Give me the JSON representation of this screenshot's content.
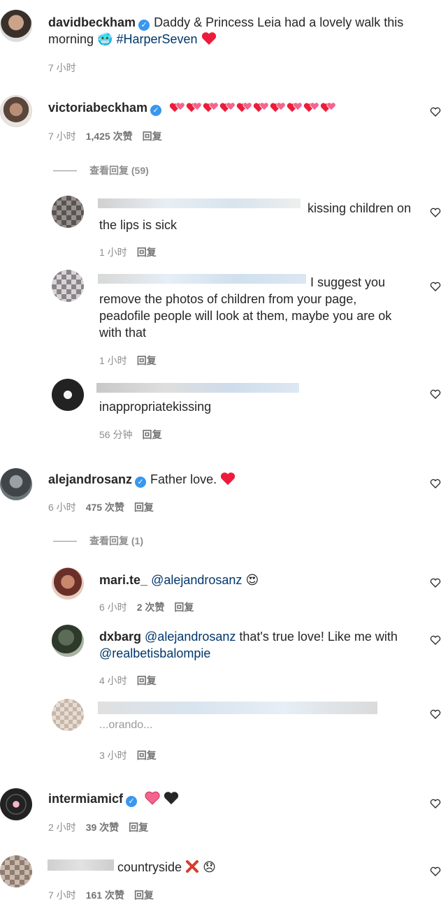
{
  "post": {
    "username": "davidbeckham",
    "text_before": "Daddy & Princess Leia had a lovely walk this morning",
    "emoji": "🥶",
    "hashtag": "#HarperSeven",
    "time": "7 小时"
  },
  "comments": [
    {
      "username": "victoriabeckham",
      "hearts_count": 10,
      "time": "7 小时",
      "likes": "1,425 次赞",
      "reply": "回复",
      "view_replies": "查看回复 (59)"
    },
    {
      "text": "kissing children on the lips is sick",
      "text_line1": "kissing children on",
      "text_line2": "the lips is sick",
      "time": "1 小时",
      "reply": "回复"
    },
    {
      "text_line1": "I suggest you",
      "text_line2": "remove the photos of children from your page,",
      "text_line3": "peadofile people will look at them, maybe you are ok",
      "text_line4": "with that",
      "time": "1 小时",
      "reply": "回复"
    },
    {
      "text": "inappropriatekissing",
      "time": "56 分钟",
      "reply": "回复"
    },
    {
      "username": "alejandrosanz",
      "text": "Father love.",
      "time": "6 小时",
      "likes": "475 次赞",
      "reply": "回复",
      "view_replies": "查看回复 (1)"
    },
    {
      "username": "mari.te_",
      "mention": "@alejandrosanz",
      "emoji": "😍",
      "time": "6 小时",
      "likes": "2 次赞",
      "reply": "回复"
    },
    {
      "username": "dxbarg",
      "mention": "@alejandrosanz",
      "text": "that's true love! Like me with",
      "mention2": "@realbetisbalompie",
      "time": "4 小时",
      "reply": "回复"
    },
    {
      "text_partial": "...orando...",
      "time": "3 小时",
      "reply": "回复"
    },
    {
      "username": "intermiamicf",
      "time": "2 小时",
      "likes": "39 次赞",
      "reply": "回复"
    },
    {
      "text": "countryside",
      "emoji": "😞",
      "time": "7 小时",
      "likes": "161 次赞",
      "reply": "回复"
    }
  ],
  "colors": {
    "heart_red": "#ed1c3a",
    "verified": "#3897f0",
    "mention": "#00376b",
    "meta": "#8e8e8e"
  }
}
